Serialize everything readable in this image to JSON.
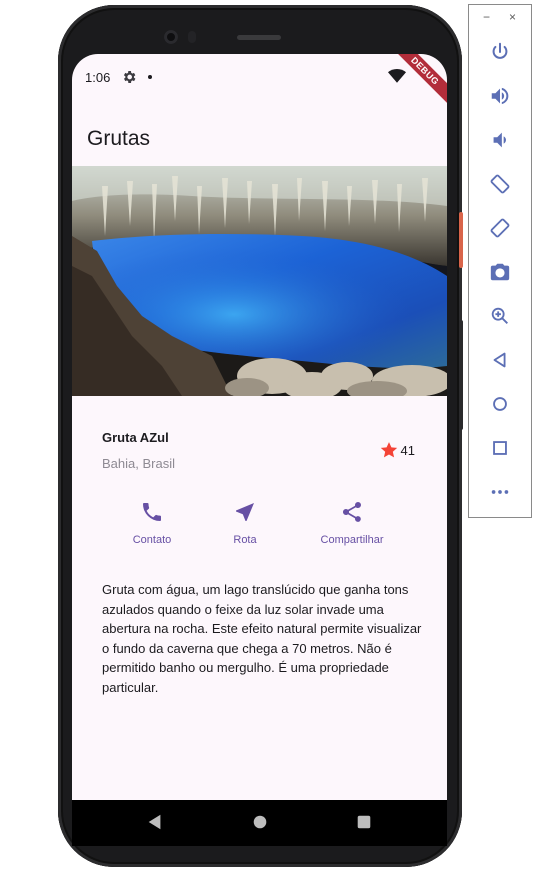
{
  "status_bar": {
    "time": "1:06",
    "debug_banner": "DEBUG"
  },
  "app_bar": {
    "title": "Grutas"
  },
  "place": {
    "name": "Gruta AZul",
    "location": "Bahia, Brasil",
    "favorite_count": "41"
  },
  "actions": [
    {
      "label": "Contato",
      "icon": "phone-icon"
    },
    {
      "label": "Rota",
      "icon": "navigation-icon"
    },
    {
      "label": "Compartilhar",
      "icon": "share-icon"
    }
  ],
  "description": "Gruta com água, um lago translúcido que ganha tons azulados quando o feixe da luz solar invade uma abertura na rocha. Este efeito natural permite visualizar o fundo da caverna que chega a 70 metros. Não é permitido banho ou mergulho. É uma propriedade particular.",
  "colors": {
    "accent": "#6750a4",
    "star": "#f44336",
    "background": "#fdf7fc",
    "text": "#1c1b1f",
    "secondary_text": "#8e8a93"
  },
  "emulator_panel": {
    "window_controls": [
      "−",
      "×"
    ],
    "tools": [
      "power-icon",
      "volume-up-icon",
      "volume-down-icon",
      "rotate-left-icon",
      "rotate-right-icon",
      "camera-icon",
      "zoom-icon",
      "back-icon",
      "home-icon",
      "overview-icon",
      "more-icon"
    ]
  }
}
